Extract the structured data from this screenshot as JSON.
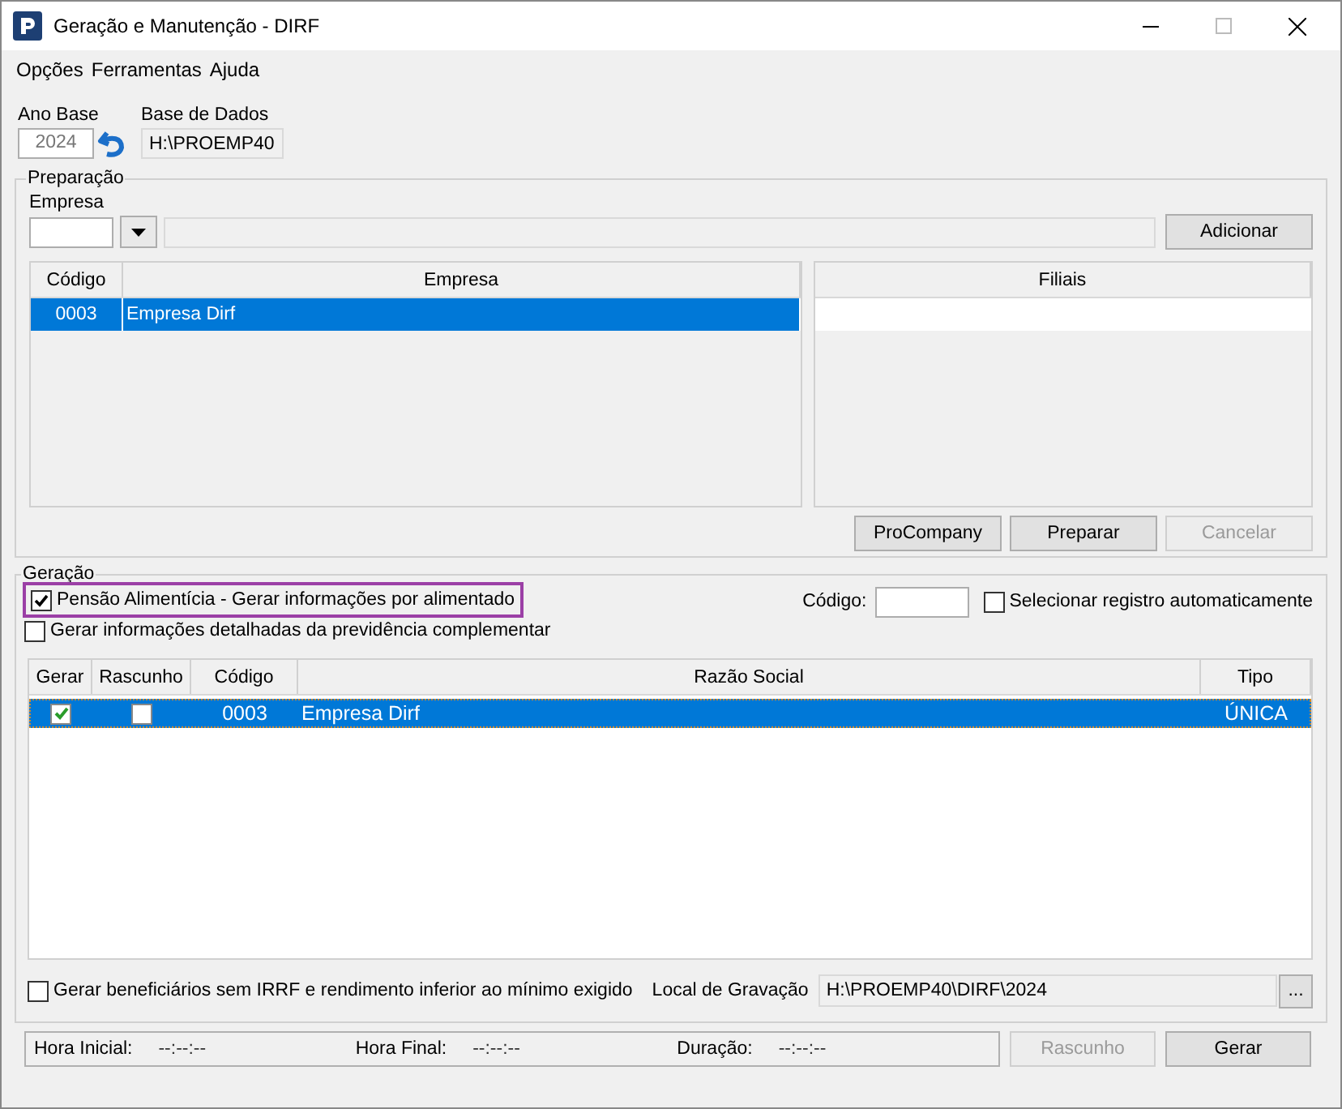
{
  "window": {
    "title": "Geração e Manutenção - DIRF"
  },
  "menu": [
    "Opções",
    "Ferramentas",
    "Ajuda"
  ],
  "ano_base": {
    "label": "Ano Base",
    "value": "2024"
  },
  "base_de_dados": {
    "label": "Base de Dados",
    "value": "H:\\PROEMP40"
  },
  "preparacao": {
    "title": "Preparação",
    "empresa_label": "Empresa",
    "add_button": "Adicionar",
    "empresas_table": {
      "columns": [
        "Código",
        "Empresa"
      ],
      "rows": [
        {
          "codigo": "0003",
          "empresa": "Empresa Dirf",
          "selected": true
        }
      ]
    },
    "filiais_table": {
      "columns": [
        "Filiais"
      ]
    },
    "buttons": [
      {
        "label": "ProCompany",
        "disabled": false
      },
      {
        "label": "Preparar",
        "disabled": false
      },
      {
        "label": "Cancelar",
        "disabled": true
      }
    ]
  },
  "geracao": {
    "title": "Geração",
    "options": [
      {
        "label": "Pensão Alimentícia - Gerar informações por alimentado",
        "checked": true,
        "highlighted": true
      },
      {
        "label": "Gerar informações detalhadas da previdência complementar",
        "checked": false,
        "highlighted": false
      }
    ],
    "codigo_label": "Código:",
    "auto_select": {
      "label": "Selecionar registro automaticamente",
      "checked": false
    },
    "table": {
      "columns": [
        "Gerar",
        "Rascunho",
        "Código",
        "Razão Social",
        "Tipo"
      ],
      "rows": [
        {
          "gerar": true,
          "rascunho": false,
          "codigo": "0003",
          "razao_social": "Empresa Dirf",
          "tipo": "ÚNICA",
          "selected": true
        }
      ]
    },
    "beneficiarios": {
      "label": "Gerar beneficiários sem IRRF e rendimento inferior ao mínimo exigido",
      "checked": false
    },
    "local_gravacao": {
      "label": "Local de Gravação",
      "value": "H:\\PROEMP40\\DIRF\\2024",
      "browse_button": "..."
    }
  },
  "status": [
    {
      "label": "Hora Inicial:",
      "value": "--:--:--"
    },
    {
      "label": "Hora Final:",
      "value": "--:--:--"
    },
    {
      "label": "Duração:",
      "value": "--:--:--"
    }
  ],
  "actions": [
    {
      "label": "Rascunho",
      "disabled": true
    },
    {
      "label": "Gerar",
      "disabled": false
    }
  ]
}
